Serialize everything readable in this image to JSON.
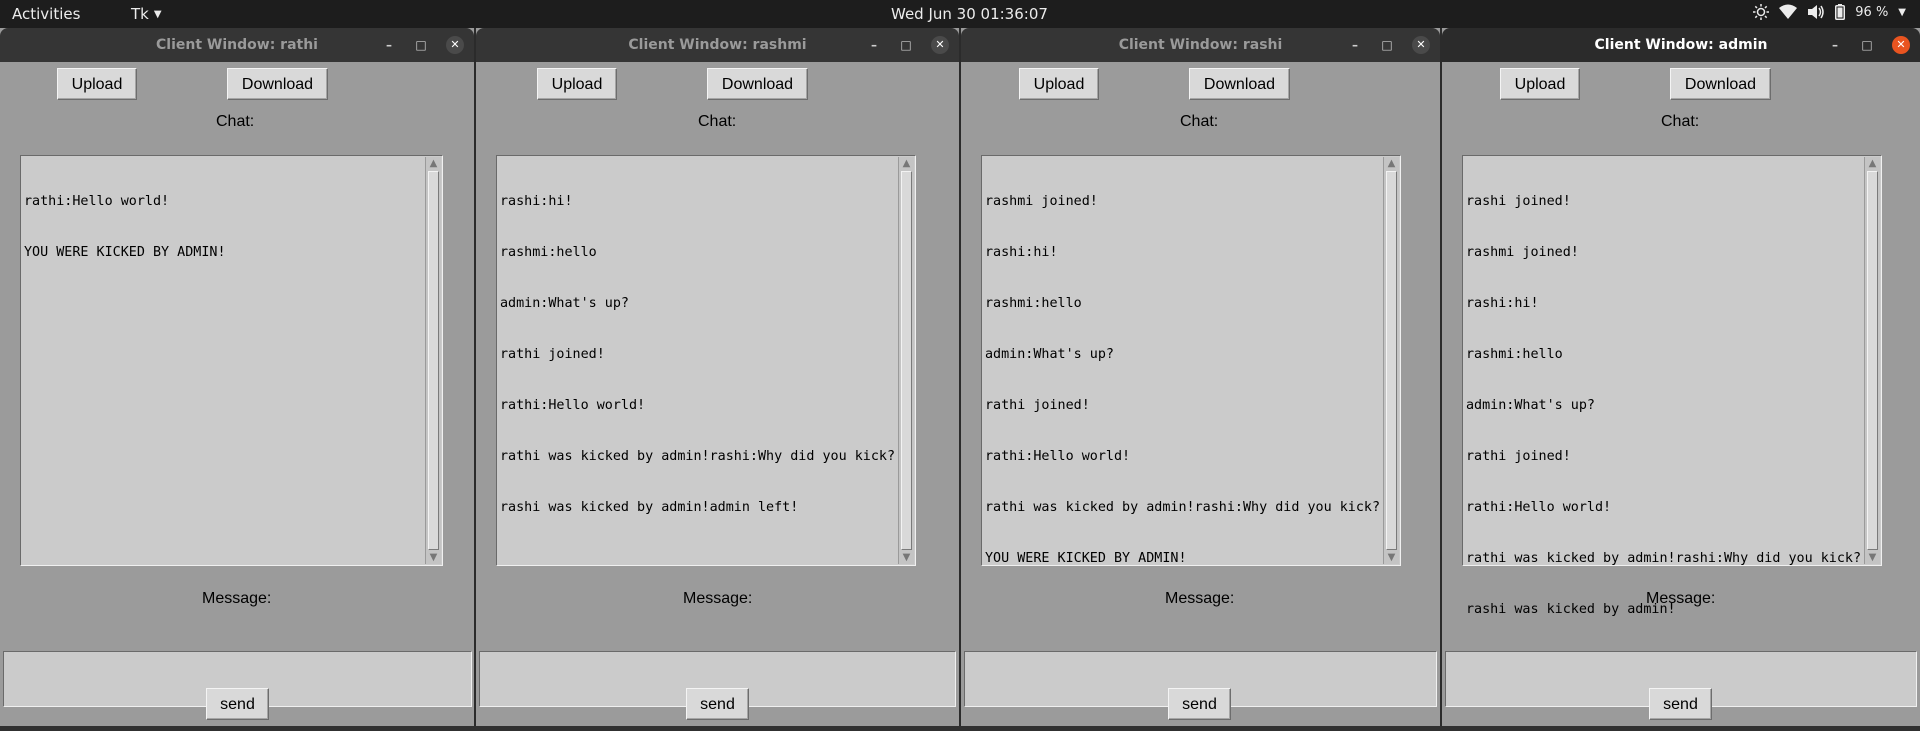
{
  "topbar": {
    "activities": "Activities",
    "app_menu": "Tk",
    "clock": "Wed Jun 30  01:36:07",
    "battery": "96 %"
  },
  "windows": [
    {
      "title": "Client Window: rathi",
      "upload": "Upload",
      "download": "Download",
      "chat_label": "Chat:",
      "chat_lines": [
        "rathi:Hello world!",
        "YOU WERE KICKED BY ADMIN!"
      ],
      "message_label": "Message:",
      "message_value": "",
      "send": "send"
    },
    {
      "title": "Client Window: rashmi",
      "upload": "Upload",
      "download": "Download",
      "chat_label": "Chat:",
      "chat_lines": [
        "rashi:hi!",
        "rashmi:hello",
        "admin:What's up?",
        "rathi joined!",
        "rathi:Hello world!",
        "rathi was kicked by admin!rashi:Why did you kick?",
        "rashi was kicked by admin!admin left!"
      ],
      "message_label": "Message:",
      "message_value": "",
      "send": "send"
    },
    {
      "title": "Client Window: rashi",
      "upload": "Upload",
      "download": "Download",
      "chat_label": "Chat:",
      "chat_lines": [
        "rashmi joined!",
        "rashi:hi!",
        "rashmi:hello",
        "admin:What's up?",
        "rathi joined!",
        "rathi:Hello world!",
        "rathi was kicked by admin!rashi:Why did you kick?",
        "YOU WERE KICKED BY ADMIN!"
      ],
      "message_label": "Message:",
      "message_value": "",
      "send": "send"
    },
    {
      "title": "Client Window: admin",
      "upload": "Upload",
      "download": "Download",
      "chat_label": "Chat:",
      "chat_lines": [
        "rashi joined!",
        "rashmi joined!",
        "rashi:hi!",
        "rashmi:hello",
        "admin:What's up?",
        "rathi joined!",
        "rathi:Hello world!",
        "rathi was kicked by admin!rashi:Why did you kick?",
        "rashi was kicked by admin!"
      ],
      "message_label": "Message:",
      "message_value": "",
      "send": "send"
    }
  ],
  "active_window": "admin"
}
